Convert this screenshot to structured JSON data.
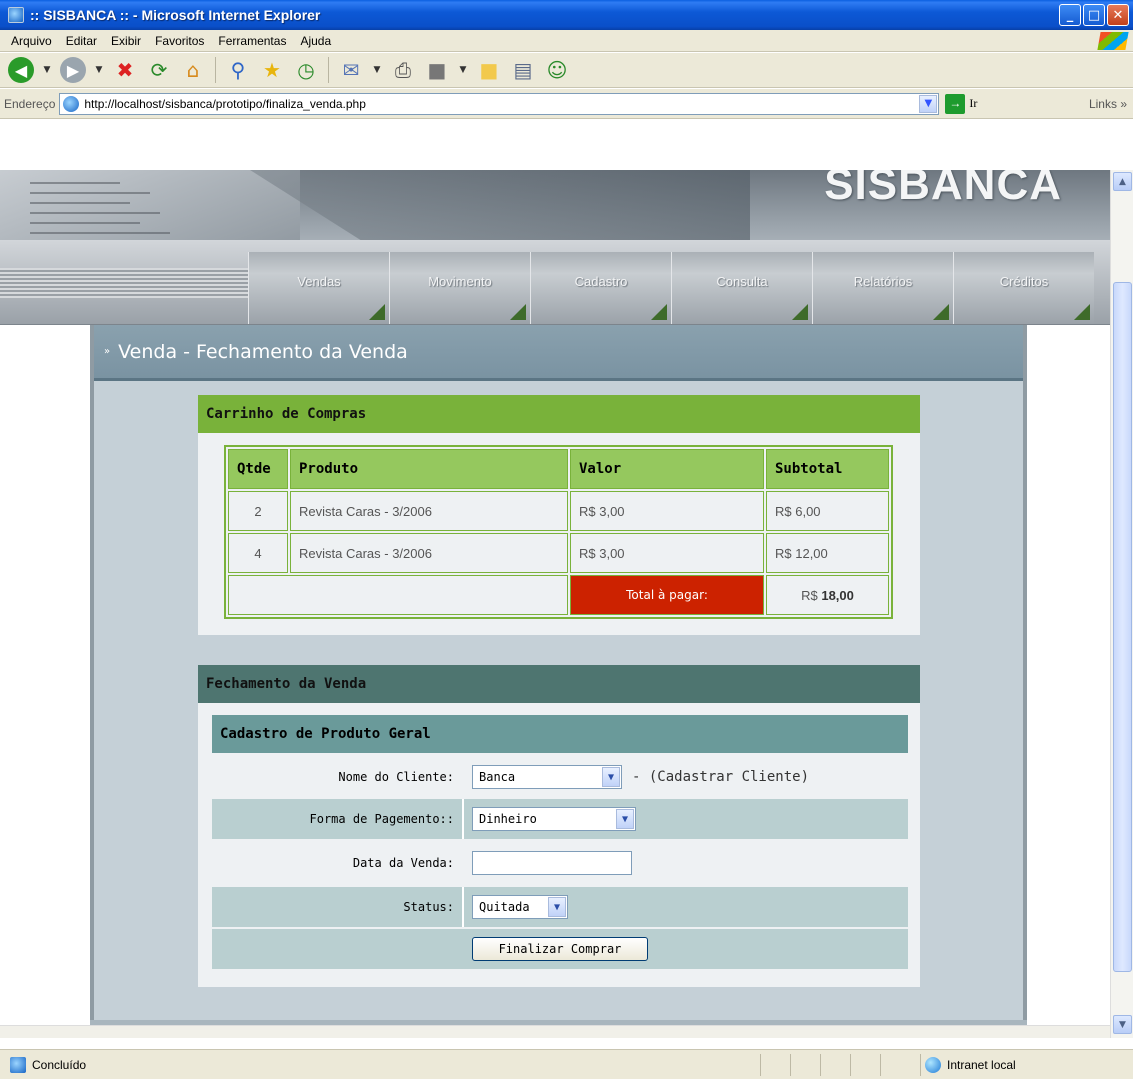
{
  "window": {
    "title": ":: SISBANCA :: - Microsoft Internet Explorer",
    "controls": [
      "minimize",
      "maximize",
      "close"
    ]
  },
  "menu": [
    "Arquivo",
    "Editar",
    "Exibir",
    "Favoritos",
    "Ferramentas",
    "Ajuda"
  ],
  "address": {
    "label": "Endereço",
    "url": "http://localhost/sisbanca/prototipo/finaliza_venda.php",
    "go_label": "Ir",
    "links_label": "Links"
  },
  "site": {
    "brand": "SISBANCA",
    "nav": [
      "Vendas",
      "Movimento",
      "Cadastro",
      "Consulta",
      "Relatórios",
      "Créditos"
    ]
  },
  "page": {
    "title": "Venda - Fechamento da Venda"
  },
  "cart": {
    "title": "Carrinho de Compras",
    "headers": [
      "Qtde",
      "Produto",
      "Valor",
      "Subtotal"
    ],
    "rows": [
      {
        "qty": "2",
        "product": "Revista Caras - 3/2006",
        "price": "R$ 3,00",
        "subtotal": "R$ 6,00"
      },
      {
        "qty": "4",
        "product": "Revista Caras - 3/2006",
        "price": "R$ 3,00",
        "subtotal": "R$ 12,00"
      }
    ],
    "total_label": "Total à pagar:",
    "total_currency": "R$",
    "total_value": "18,00"
  },
  "closing": {
    "title": "Fechamento da Venda",
    "subtitle": "Cadastro de Produto Geral",
    "client_label": "Nome do Cliente:",
    "client_value": "Banca",
    "client_link": "- (Cadastrar Cliente)",
    "payment_label": "Forma de Pagemento::",
    "payment_value": "Dinheiro",
    "date_label": "Data da Venda:",
    "date_value": "",
    "status_label": "Status:",
    "status_value": "Quitada",
    "submit_label": "Finalizar Comprar"
  },
  "status": {
    "text": "Concluído",
    "zone": "Intranet local"
  },
  "colors": {
    "cart_header": "#79b23a",
    "total_bg": "#cc2200",
    "closing_header": "#4e7570",
    "subheader": "#6a9a9a"
  }
}
